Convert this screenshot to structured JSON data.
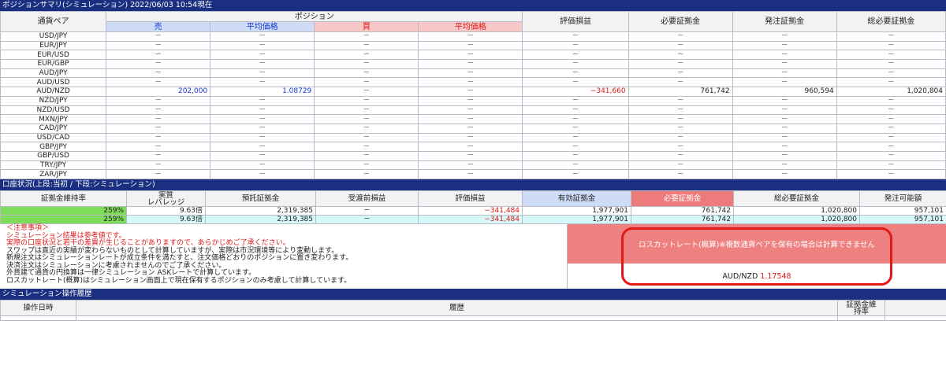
{
  "summary": {
    "title": "ポジションサマリ(シミュレーション)",
    "timestamp": "2022/06/03 10:54現在"
  },
  "position_table": {
    "headers": {
      "pair": "通貨ペア",
      "position": "ポジション",
      "sell": "売",
      "sell_avg": "平均価格",
      "buy": "買",
      "buy_avg": "平均価格",
      "pnl": "評価損益",
      "required_margin": "必要証拠金",
      "order_margin": "発注証拠金",
      "total_margin": "総必要証拠金"
    },
    "rows": [
      {
        "pair": "USD/JPY",
        "sell": "－",
        "sell_avg": "－",
        "buy": "－",
        "buy_avg": "－",
        "pnl": "－",
        "req": "－",
        "order": "－",
        "total": "－"
      },
      {
        "pair": "EUR/JPY",
        "sell": "－",
        "sell_avg": "－",
        "buy": "－",
        "buy_avg": "－",
        "pnl": "－",
        "req": "－",
        "order": "－",
        "total": "－"
      },
      {
        "pair": "EUR/USD",
        "sell": "－",
        "sell_avg": "－",
        "buy": "－",
        "buy_avg": "－",
        "pnl": "－",
        "req": "－",
        "order": "－",
        "total": "－"
      },
      {
        "pair": "EUR/GBP",
        "sell": "－",
        "sell_avg": "－",
        "buy": "－",
        "buy_avg": "－",
        "pnl": "－",
        "req": "－",
        "order": "－",
        "total": "－"
      },
      {
        "pair": "AUD/JPY",
        "sell": "－",
        "sell_avg": "－",
        "buy": "－",
        "buy_avg": "－",
        "pnl": "－",
        "req": "－",
        "order": "－",
        "total": "－"
      },
      {
        "pair": "AUD/USD",
        "sell": "－",
        "sell_avg": "－",
        "buy": "－",
        "buy_avg": "－",
        "pnl": "－",
        "req": "－",
        "order": "－",
        "total": "－"
      },
      {
        "pair": "AUD/NZD",
        "sell": "202,000",
        "sell_avg": "1.08729",
        "buy": "－",
        "buy_avg": "－",
        "pnl": "−341,660",
        "req": "761,742",
        "order": "960,594",
        "total": "1,020,804"
      },
      {
        "pair": "NZD/JPY",
        "sell": "－",
        "sell_avg": "－",
        "buy": "－",
        "buy_avg": "－",
        "pnl": "－",
        "req": "－",
        "order": "－",
        "total": "－"
      },
      {
        "pair": "NZD/USD",
        "sell": "－",
        "sell_avg": "－",
        "buy": "－",
        "buy_avg": "－",
        "pnl": "－",
        "req": "－",
        "order": "－",
        "total": "－"
      },
      {
        "pair": "MXN/JPY",
        "sell": "－",
        "sell_avg": "－",
        "buy": "－",
        "buy_avg": "－",
        "pnl": "－",
        "req": "－",
        "order": "－",
        "total": "－"
      },
      {
        "pair": "CAD/JPY",
        "sell": "－",
        "sell_avg": "－",
        "buy": "－",
        "buy_avg": "－",
        "pnl": "－",
        "req": "－",
        "order": "－",
        "total": "－"
      },
      {
        "pair": "USD/CAD",
        "sell": "－",
        "sell_avg": "－",
        "buy": "－",
        "buy_avg": "－",
        "pnl": "－",
        "req": "－",
        "order": "－",
        "total": "－"
      },
      {
        "pair": "GBP/JPY",
        "sell": "－",
        "sell_avg": "－",
        "buy": "－",
        "buy_avg": "－",
        "pnl": "－",
        "req": "－",
        "order": "－",
        "total": "－"
      },
      {
        "pair": "GBP/USD",
        "sell": "－",
        "sell_avg": "－",
        "buy": "－",
        "buy_avg": "－",
        "pnl": "－",
        "req": "－",
        "order": "－",
        "total": "－"
      },
      {
        "pair": "TRY/JPY",
        "sell": "－",
        "sell_avg": "－",
        "buy": "－",
        "buy_avg": "－",
        "pnl": "－",
        "req": "－",
        "order": "－",
        "total": "－"
      },
      {
        "pair": "ZAR/JPY",
        "sell": "－",
        "sell_avg": "－",
        "buy": "－",
        "buy_avg": "－",
        "pnl": "－",
        "req": "－",
        "order": "－",
        "total": "－"
      }
    ]
  },
  "account": {
    "title": "口座状況(上段:当初 / 下段:シミュレーション)",
    "headers": {
      "margin_rate": "証拠金維持率",
      "leverage_1": "実質",
      "leverage_2": "レバレッジ",
      "deposit": "預託証拠金",
      "pre_settle": "受渡前損益",
      "pnl": "評価損益",
      "effective": "有効証拠金",
      "required": "必要証拠金",
      "total_required": "総必要証拠金",
      "available": "発注可能額"
    },
    "rows": [
      {
        "margin_rate": "259%",
        "leverage": "9.63倍",
        "deposit": "2,319,385",
        "pre_settle": "－",
        "pnl": "−341,484",
        "effective": "1,977,901",
        "required": "761,742",
        "total_required": "1,020,800",
        "available": "957,101"
      },
      {
        "margin_rate": "259%",
        "leverage": "9.63倍",
        "deposit": "2,319,385",
        "pre_settle": "－",
        "pnl": "−341,484",
        "effective": "1,977,901",
        "required": "761,742",
        "total_required": "1,020,800",
        "available": "957,101"
      }
    ]
  },
  "notes": {
    "heading": "＜注意事項＞",
    "line1": "シミュレーション結果は参考値です。",
    "line2": "実際の口座状況と若干の差異が生じることがありますので、あらかじめご了承ください。",
    "line3": "スワップは直近の実績が変わらないものとして計算していますが、実際は市況環境等により変動します。",
    "line4": "新規注文はシミュレーションレートが成立条件を満たすと、注文価格どおりのポジションに置き変わります。",
    "line5": "決済注文はシミュレーションに考慮されませんのでご了承ください。",
    "line6": "外貨建て通貨の円換算は一律シミュレーション ASKレートで計算しています。",
    "line7": "ロスカットレート(概算)はシミュレーション画面上で現在保有するポジションのみ考慮して計算しています。"
  },
  "losscut": {
    "title": "ロスカットレート(概算)※複数通貨ペアを保有の場合は計算できません",
    "pair": "AUD/NZD",
    "rate": "1.17548"
  },
  "history": {
    "title": "シミュレーション操作履歴",
    "col_datetime": "操作日時",
    "col_history": "履歴",
    "col_rate_1": "証拠金維",
    "col_rate_2": "持率"
  }
}
